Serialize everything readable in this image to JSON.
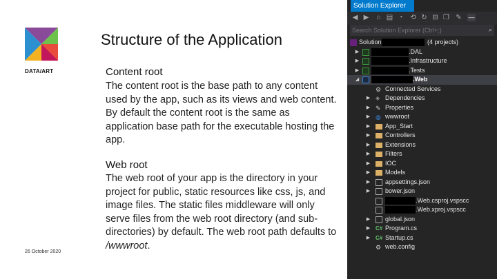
{
  "slide": {
    "title": "Structure of the Application",
    "brand": "DATA/ART",
    "date": "26 October 2020",
    "sections": [
      {
        "heading": "Content root",
        "body": "The content root is the base path to any content used by the app, such as its views and web content. By default the content root is the same as application base path for the executable hosting the app."
      },
      {
        "heading": "Web root",
        "body_pre": "The web root of your app is the directory in your project for public, static resources like css, js, and image files. The static files middleware will only serve files from the web root directory (and sub-directories) by default. The web root path defaults to ",
        "body_em": "/wwwroot",
        "body_post": "."
      }
    ]
  },
  "solution_explorer": {
    "tab_title": "Solution Explorer",
    "search_placeholder": "Search Solution Explorer (Ctrl+;)",
    "solution_label": "Solution",
    "solution_suffix": "(4 projects)",
    "projects": [
      ".DAL",
      ".Infrastructure",
      ".Tests",
      ".Web"
    ],
    "web_items": [
      "Connected Services",
      "Dependencies",
      "Properties",
      "wwwroot",
      "App_Start",
      "Controllers",
      "Extensions",
      "Filters",
      "IOC",
      "Models",
      "appsettings.json",
      "bower.json",
      ".Web.csproj.vspscc",
      ".Web.xproj.vspscc",
      "global.json",
      "Program.cs",
      "Startup.cs",
      "web.config"
    ]
  }
}
